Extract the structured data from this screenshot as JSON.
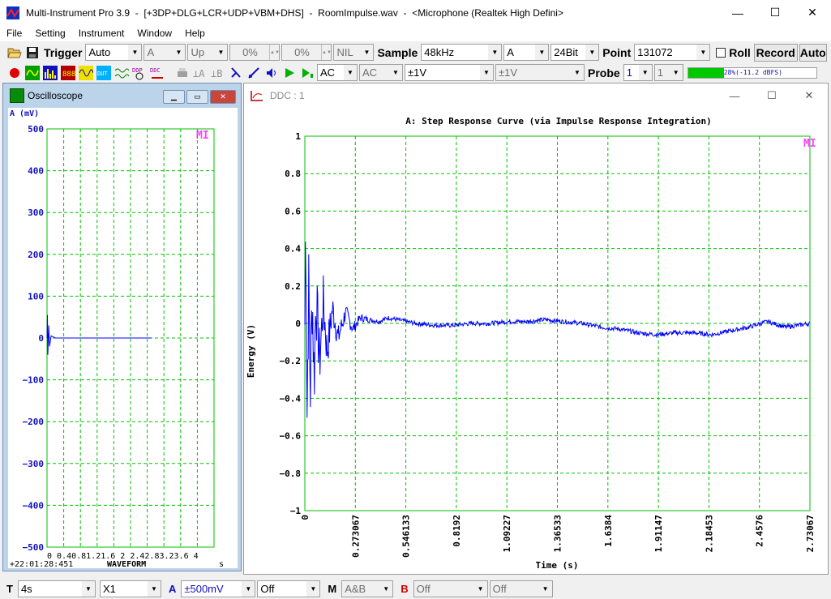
{
  "window": {
    "app_name": "Multi-Instrument Pro 3.9",
    "modules": "[+3DP+DLG+LCR+UDP+VBM+DHS]",
    "file": "RoomImpulse.wav",
    "device": "<Microphone (Realtek High Defini>",
    "minimize": "—",
    "maximize": "☐",
    "close": "✕"
  },
  "menu": [
    "File",
    "Setting",
    "Instrument",
    "Window",
    "Help"
  ],
  "toolbar1": {
    "trigger_label": "Trigger",
    "trigger_mode": "Auto",
    "trigger_channel": "A",
    "trigger_edge": "Up",
    "level1": "0%",
    "level2": "0%",
    "nil": "NIL",
    "sample_label": "Sample",
    "sample_rate": "48kHz",
    "channel": "A",
    "bits": "24Bit",
    "point_label": "Point",
    "points": "131072",
    "roll_label": "Roll",
    "record_button": "Record",
    "auto_button": "Auto"
  },
  "toolbar2": {
    "coupling_a": "AC",
    "coupling_b": "AC",
    "range_a": "±1V",
    "range_b": "±1V",
    "probe_label": "Probe",
    "probe_a": "1",
    "probe_b": "1",
    "level_meter_text": "28%(-11.2 dBFS)",
    "level_meter_fraction": 0.28
  },
  "oscilloscope": {
    "title": "Oscilloscope",
    "unit_label": "A (mV)",
    "logo": "MI",
    "y_ticks": [
      "500",
      "400",
      "300",
      "200",
      "100",
      "0",
      "−100",
      "−200",
      "−300",
      "−400",
      "−500"
    ],
    "x_ticks": "0 0.40.81.21.6 2 2.42.83.23.6 4",
    "x_unit": "s",
    "timestamp": "+22:01:28:451",
    "mode_label": "WAVEFORM"
  },
  "ddc": {
    "title": "DDC : 1",
    "chart_title": "A: Step Response Curve (via Impulse Response Integration)",
    "logo": "MI",
    "y_label": "Energy (V)",
    "x_label": "Time (s)",
    "y_ticks": [
      "1",
      "0.8",
      "0.6",
      "0.4",
      "0.2",
      "0",
      "−0.2",
      "−0.4",
      "−0.6",
      "−0.8",
      "−1"
    ],
    "x_ticks": [
      "0",
      "0.273067",
      "0.546133",
      "0.8192",
      "1.09227",
      "1.36533",
      "1.6384",
      "1.91147",
      "2.18453",
      "2.4576",
      "2.73067"
    ]
  },
  "chart_data": [
    {
      "type": "line",
      "title": "A: Step Response Curve (via Impulse Response Integration)",
      "xlabel": "Time (s)",
      "ylabel": "Energy (V)",
      "xlim": [
        0,
        2.73067
      ],
      "ylim": [
        -1,
        1
      ],
      "grid": true,
      "line_color": "#0000ff",
      "grid_color": "#00c000",
      "series": [
        {
          "x": [
            0,
            0.005,
            0.012,
            0.02,
            0.03,
            0.04,
            0.05,
            0.06,
            0.08,
            0.1,
            0.12,
            0.15,
            0.18,
            0.22,
            0.26,
            0.3,
            0.35,
            0.4,
            0.45,
            0.5,
            0.55,
            0.6,
            0.7,
            0.8,
            0.9,
            1.0,
            1.1,
            1.2,
            1.3,
            1.4,
            1.5,
            1.6,
            1.7,
            1.8,
            1.9,
            2.0,
            2.1,
            2.2,
            2.3,
            2.4,
            2.5,
            2.6,
            2.73067
          ],
          "y": [
            0,
            0.65,
            -0.48,
            0.22,
            -0.35,
            0.18,
            -0.3,
            0.15,
            -0.2,
            0.12,
            -0.15,
            0.08,
            -0.08,
            0.06,
            -0.03,
            0.03,
            0.02,
            0.01,
            0.03,
            0.02,
            0.01,
            0.0,
            -0.01,
            -0.01,
            0.0,
            0.0,
            0.01,
            0.01,
            0.02,
            0.01,
            0.0,
            -0.02,
            -0.03,
            -0.05,
            -0.06,
            -0.05,
            -0.05,
            -0.06,
            -0.04,
            -0.02,
            0.01,
            -0.02,
            0.0
          ]
        }
      ]
    },
    {
      "type": "line",
      "title": "",
      "xlabel": "s",
      "ylabel": "A (mV)",
      "xlim": [
        0,
        4
      ],
      "ylim": [
        -500,
        500
      ],
      "grid": true,
      "line_color": "#0000ff",
      "series": [
        {
          "x": [
            0,
            0.01,
            0.02,
            0.04,
            0.06,
            0.1,
            0.2,
            0.5,
            1.0,
            1.5,
            2.0,
            2.5
          ],
          "y": [
            0,
            55,
            -40,
            30,
            -20,
            5,
            0,
            0,
            0,
            0,
            0,
            0
          ]
        }
      ]
    }
  ],
  "statusbar": {
    "t_label": "T",
    "timebase": "4s",
    "multiplier": "X1",
    "a_label": "A",
    "a_range": "±500mV",
    "a_offset": "Off",
    "m_label": "M",
    "m_mode": "A&B",
    "b_label": "B",
    "b_range": "Off",
    "b_offset": "Off"
  }
}
